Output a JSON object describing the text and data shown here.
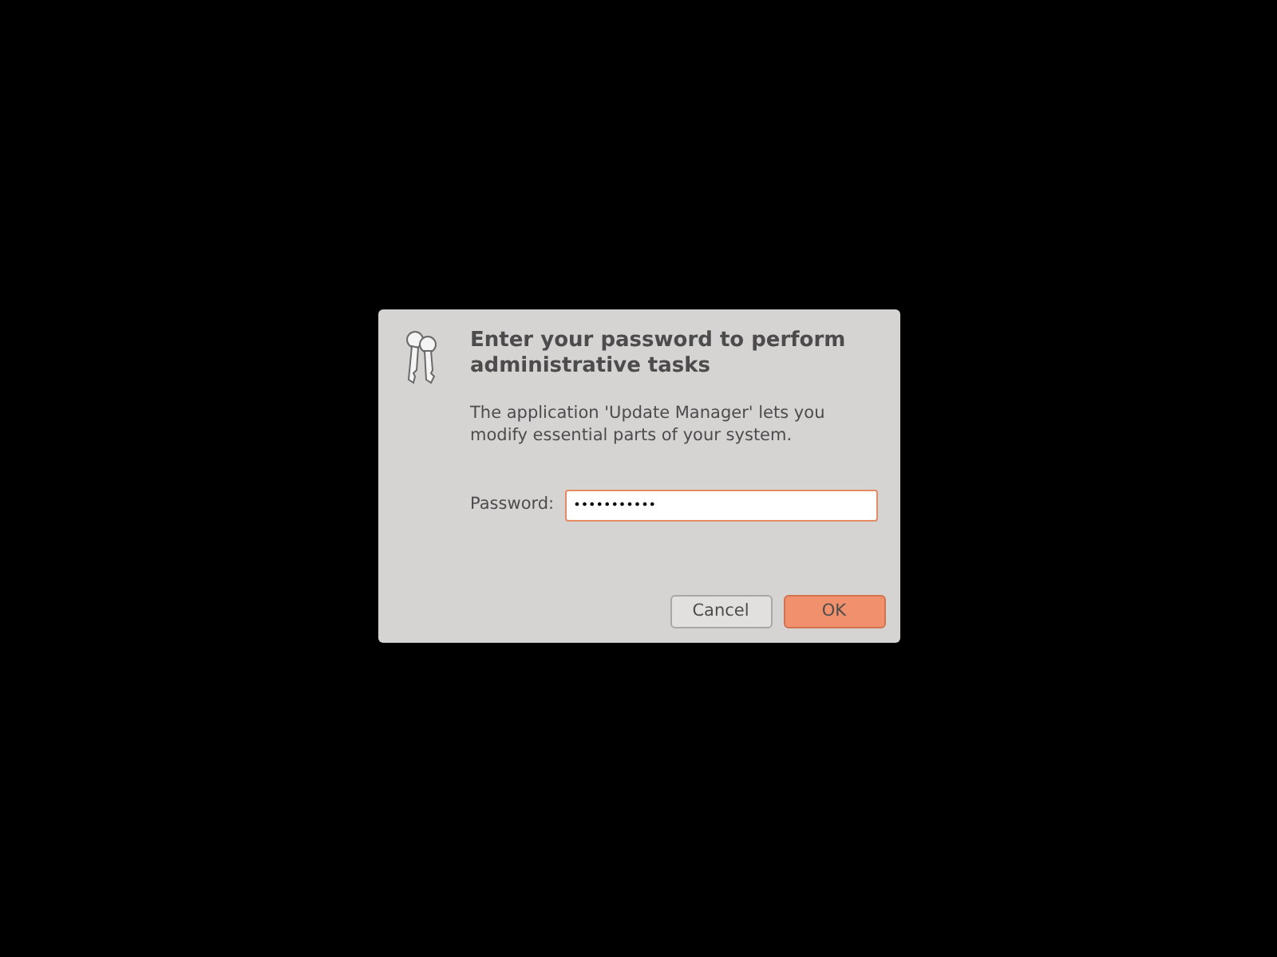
{
  "dialog": {
    "title": "Enter your password to perform administrative tasks",
    "message": "The application 'Update Manager' lets you modify essential parts of your system.",
    "password": {
      "label": "Password:",
      "value": "•••••••••••",
      "focused": true
    },
    "buttons": [
      {
        "label": "Cancel",
        "default": false
      },
      {
        "label": "OK",
        "default": true
      }
    ]
  }
}
